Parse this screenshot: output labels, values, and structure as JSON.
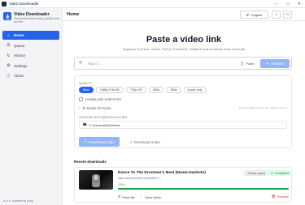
{
  "window": {
    "title": "Video Downloader"
  },
  "sidebar": {
    "brand_name": "Video Downloader",
    "brand_tagline": "Download videos easily, quickly and ad-free",
    "items": [
      {
        "label": "Home",
        "icon": "home-icon",
        "active": true
      },
      {
        "label": "Queue",
        "icon": "queue-icon",
        "active": false
      },
      {
        "label": "History",
        "icon": "history-icon",
        "active": false
      },
      {
        "label": "Settings",
        "icon": "settings-icon",
        "active": false
      },
      {
        "label": "About",
        "icon": "info-icon",
        "active": false
      }
    ],
    "version": "v0.1.0 · powered by yt-dlp"
  },
  "header": {
    "title": "Home",
    "language": "English"
  },
  "hero": {
    "title": "Paste a video link",
    "subtitle": "Supports YouTube, Vimeo, TikTok, Facebook, Twitter/X and hundreds more via yt-dlp"
  },
  "url_input": {
    "placeholder": "https://...",
    "value": "",
    "paste_label": "Paste",
    "analyze_label": "Analyze"
  },
  "options": {
    "quality_label": "QUALITY",
    "qualities": [
      "Best",
      "1080p Full HD",
      "720p HD",
      "480p",
      "360p",
      "Audio only"
    ],
    "selected_quality": "Best",
    "subtitles_label": "DOWNLOAD SUBTITLES",
    "subtitles_checked": false,
    "more_options_label": "MORE OPTIONS",
    "more_options_hint": "Includes Queue format, trim, quality, network",
    "folder_label": "CHOOSE DESTINATION FOLDER",
    "folder_path": "C:\\Users\\atlas\\Videos",
    "download_video_label": "Download video",
    "download_audio_label": "Download audio"
  },
  "recent": {
    "title": "Recent downloads",
    "items": [
      {
        "title": "Dance To The Drummer's Beat (Masta Hankoto)",
        "url": "https://www.youtube.com/watch?v=...",
        "format": "1920px (mp4)",
        "status": "Completed",
        "progress_text": "100%",
        "progress": 1.0,
        "show_label": "Show file",
        "open_label": "Open folder",
        "remove_label": "Remove"
      }
    ]
  },
  "colors": {
    "accent": "#2563eb",
    "accent_disabled": "#93b4f6",
    "success": "#16a34a",
    "danger": "#dc2626"
  }
}
